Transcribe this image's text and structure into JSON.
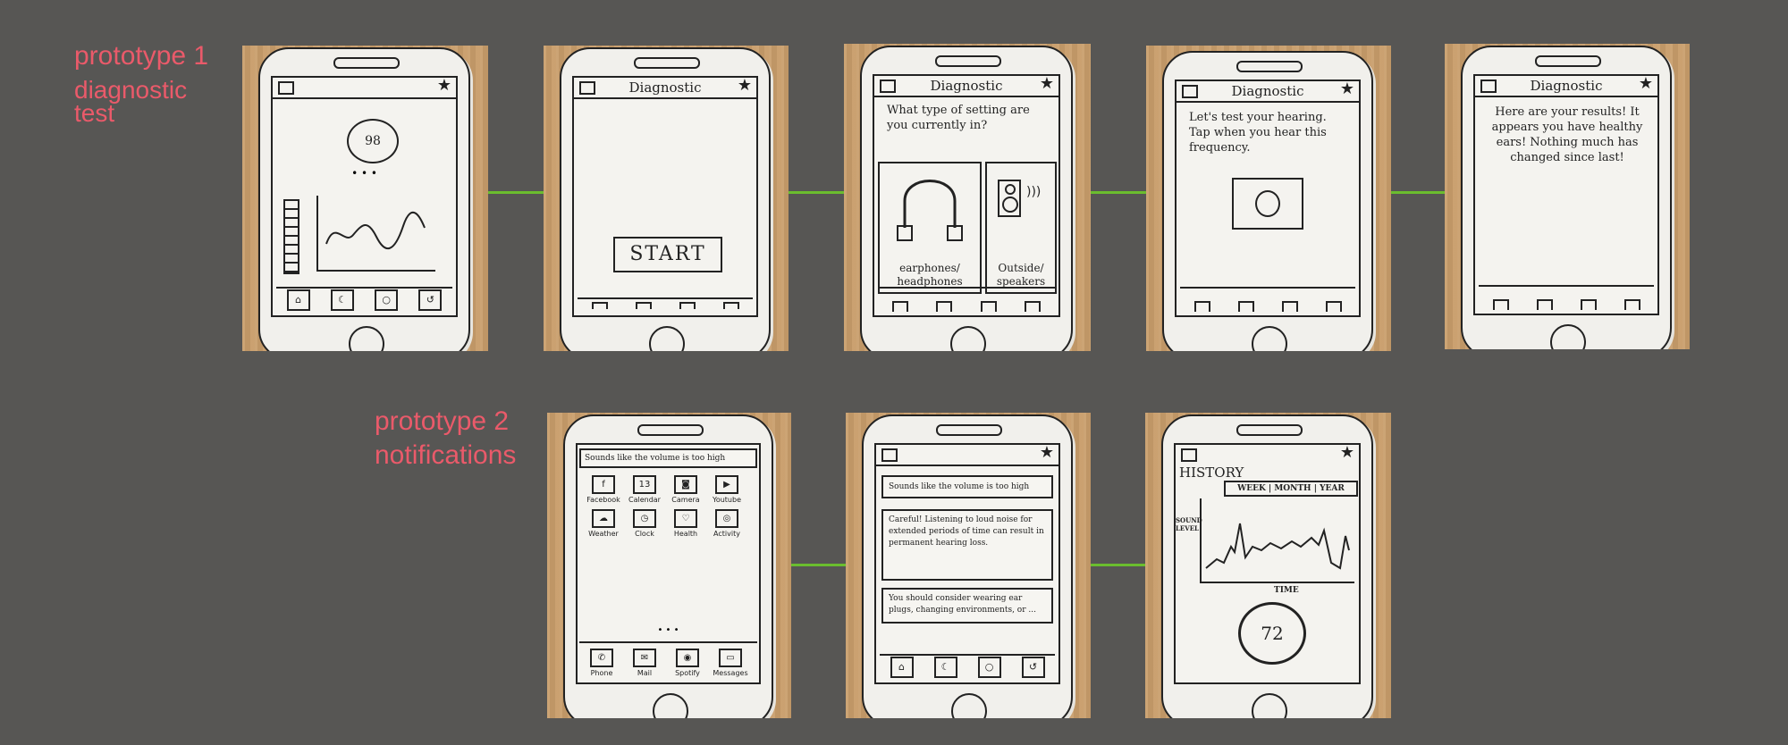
{
  "labels": {
    "prototype1_line1": "prototype 1",
    "prototype1_line2": "diagnostic",
    "prototype1_line3": "test",
    "prototype2_line1": "prototype 2",
    "prototype2_line2": "notifications"
  },
  "colors": {
    "background": "#575654",
    "label": "#ea5a6a",
    "connector": "#6bbd2e"
  },
  "sketch1": {
    "score": "98",
    "dots": "• • •"
  },
  "sketch2": {
    "title": "Diagnostic",
    "start_button": "START"
  },
  "sketch3": {
    "title": "Diagnostic",
    "question": "What type of setting are you currently in?",
    "option_a": "earphones/ headphones",
    "option_b": "Outside/ speakers"
  },
  "sketch4": {
    "title": "Diagnostic",
    "instruction": "Let's test your hearing. Tap when you hear this frequency."
  },
  "sketch5": {
    "title": "Diagnostic",
    "result": "Here are your results! It appears you have healthy ears! Nothing much has changed since last!"
  },
  "sketch6": {
    "banner": "Sounds like the volume is too high",
    "apps": [
      "Facebook",
      "Calendar",
      "Camera",
      "Youtube",
      "Weather",
      "Clock",
      "Health",
      "Activity"
    ],
    "calendar_day": "13",
    "dots": "• • •",
    "dock": [
      "Phone",
      "Mail",
      "Spotify",
      "Messages"
    ]
  },
  "sketch7": {
    "notice1": "Sounds like the volume is too high",
    "notice2": "Careful! Listening to loud noise for extended periods of time can result in permanent hearing loss.",
    "notice3": "You should consider wearing ear plugs, changing environments, or ..."
  },
  "sketch8": {
    "heading": "HISTORY",
    "tabs": "WEEK | MONTH | YEAR",
    "ylabel": "SOUND LEVEL",
    "xlabel": "TIME",
    "level": "72"
  }
}
